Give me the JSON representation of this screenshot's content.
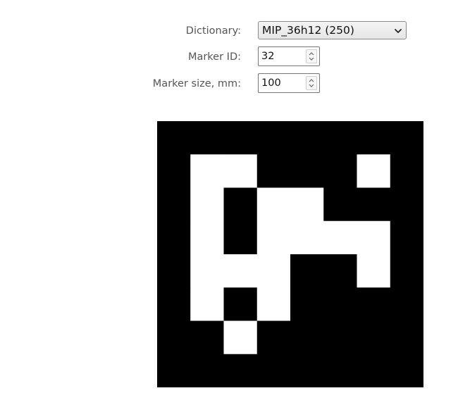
{
  "form": {
    "dictionary": {
      "label": "Dictionary:",
      "selected": "MIP_36h12 (250)"
    },
    "marker_id": {
      "label": "Marker ID:",
      "value": "32"
    },
    "marker_size": {
      "label": "Marker size, mm:",
      "value": "100"
    }
  },
  "icons": {
    "dropdown": "chevron-down-icon",
    "spinner": "spin-up-down-icon"
  },
  "marker": {
    "grid_size": 8,
    "bits": [
      [
        0,
        0,
        0,
        0,
        0,
        0,
        0,
        0
      ],
      [
        0,
        1,
        1,
        0,
        0,
        0,
        1,
        0
      ],
      [
        0,
        1,
        0,
        1,
        1,
        0,
        0,
        0
      ],
      [
        0,
        1,
        0,
        1,
        1,
        1,
        1,
        0
      ],
      [
        0,
        1,
        1,
        1,
        0,
        0,
        1,
        0
      ],
      [
        0,
        1,
        0,
        1,
        0,
        0,
        0,
        0
      ],
      [
        0,
        0,
        1,
        0,
        0,
        0,
        0,
        0
      ],
      [
        0,
        0,
        0,
        0,
        0,
        0,
        0,
        0
      ]
    ],
    "colors": {
      "black": "#000000",
      "white": "#ffffff"
    }
  }
}
